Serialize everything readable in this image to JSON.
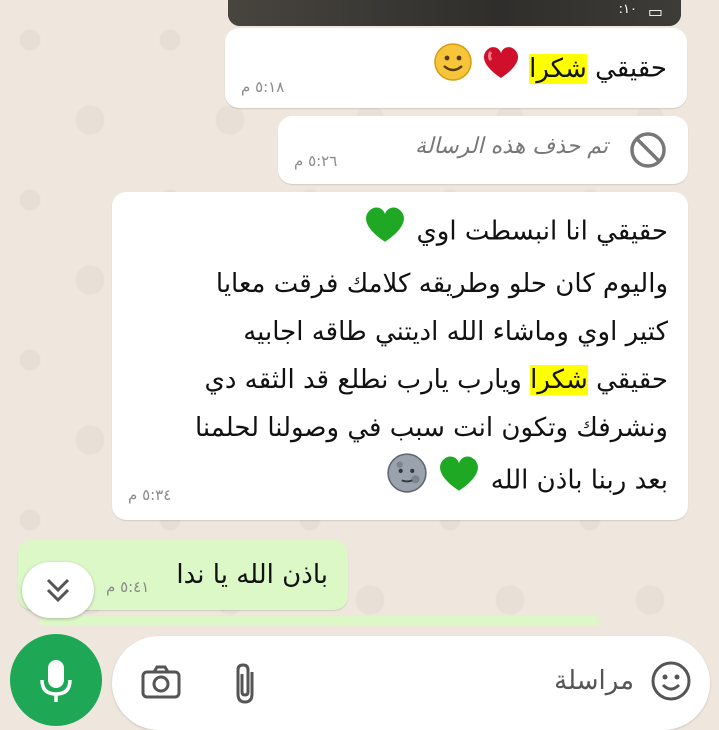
{
  "chat": {
    "media_time": ":١٠",
    "messages": [
      {
        "type": "incoming",
        "line1_pre": "حقيقي ",
        "line1_highlight": "شكرا",
        "time": "٥:١٨ م"
      },
      {
        "type": "deleted",
        "text": "تم حذف هذه الرسالة",
        "time": "٥:٢٦ م"
      },
      {
        "type": "incoming",
        "line1": "حقيقي انا انبسطت اوي",
        "line2": "واليوم كان حلو وطريقه كلامك فرقت معايا",
        "line3": "كتير اوي وماشاء الله اديتني طاقه اجابيه",
        "line4_pre": "حقيقي ",
        "line4_highlight": "شكرا",
        "line4_post": " ويارب يارب نطلع قد الثقه دي",
        "line5": "ونشرفك وتكون انت سبب في وصولنا لحلمنا",
        "line6": "بعد ربنا باذن الله",
        "time": "٥:٣٤ م"
      },
      {
        "type": "outgoing",
        "text": "باذن الله يا ندا",
        "time": "٥:٤١ م"
      }
    ]
  },
  "composer": {
    "placeholder": "مراسلة",
    "icons": [
      "emoji-icon",
      "attach-icon",
      "camera-icon",
      "mic-icon"
    ]
  },
  "colors": {
    "accent": "#1ea855",
    "outgoing_bubble": "#dcf8c6",
    "highlight": "#ffff00"
  }
}
